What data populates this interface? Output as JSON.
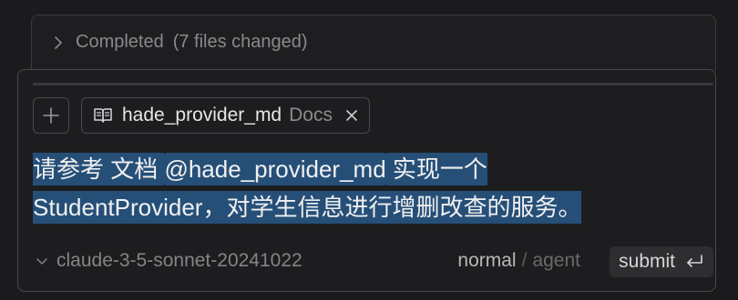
{
  "completed": {
    "label": "Completed",
    "detail": "(7 files changed)"
  },
  "composer": {
    "chip": {
      "name": "hade_provider_md",
      "type": "Docs"
    },
    "prompt": {
      "line1_prefix": "请参考 文档 ",
      "mention": "@hade_provider_md",
      "line1_suffix": " 实现一个",
      "line2": "StudentProvider，对学生信息进行增删改查的服务。"
    },
    "footer": {
      "model": "claude-3-5-sonnet-20241022",
      "mode_normal": "normal",
      "mode_separator": "/",
      "mode_agent": "agent",
      "submit_label": "submit"
    }
  },
  "icons": {
    "completed": "chevron-right-icon",
    "add": "plus-icon",
    "chip": "book-icon",
    "chip_close": "close-icon",
    "model": "chevron-down-icon",
    "submit": "return-icon"
  },
  "colors": {
    "background": "#1b1b1d",
    "selection": "#264f78",
    "mention": "#2f5d8c"
  }
}
